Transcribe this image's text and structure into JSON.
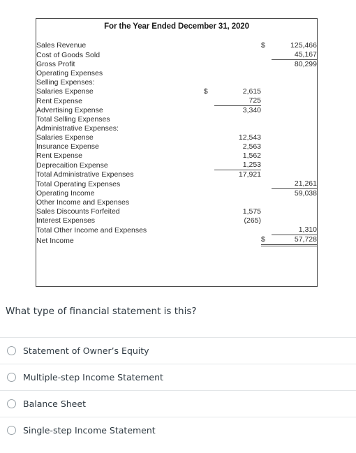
{
  "statement": {
    "title": "For the Year Ended December 31, 2020",
    "rows": [
      {
        "label": "Sales Revenue",
        "indent": 0,
        "cur2": "$",
        "num2": "125,466"
      },
      {
        "label": "Cost of Goods Sold",
        "indent": 0,
        "num2": "45,167",
        "rule2": "under"
      },
      {
        "label": "Gross Profit",
        "indent": 0,
        "num2": "80,299"
      },
      {
        "label": "Operating Expenses",
        "indent": 0
      },
      {
        "label": "Selling Expenses:",
        "indent": 1
      },
      {
        "label": "Salaries Expense",
        "indent": 2,
        "cur1": "$",
        "num1": "2,615"
      },
      {
        "label": "Rent Expense",
        "indent": 2,
        "num1": "725",
        "rule1": "under"
      },
      {
        "label": "Advertising Expense",
        "indent": 2,
        "num1": "3,340"
      },
      {
        "label": "Total Selling Expenses",
        "indent": 2
      },
      {
        "label": "Administrative Expenses:",
        "indent": 1
      },
      {
        "label": "Salaries Expense",
        "indent": 2,
        "num1": "12,543"
      },
      {
        "label": "Insurance Expense",
        "indent": 2,
        "num1": "2,563"
      },
      {
        "label": "Rent Expense",
        "indent": 2,
        "num1": "1,562"
      },
      {
        "label": "Deprecaition Expense",
        "indent": 2,
        "num1": "1,253",
        "rule1": "under"
      },
      {
        "label": "Total Administrative Expenses",
        "indent": 2,
        "num1": "17,921"
      },
      {
        "label": "Total Operating Expenses",
        "indent": 1,
        "num2": "21,261",
        "rule2": "under"
      },
      {
        "label": "Operating Income",
        "indent": 0,
        "num2": "59,038"
      },
      {
        "label": "Other Income and Expenses",
        "indent": 0
      },
      {
        "label": "Sales Discounts Forfeited",
        "indent": 2,
        "num1": "1,575"
      },
      {
        "label": "Interest Expenses",
        "indent": 2,
        "num1": "(265)"
      },
      {
        "label": "Total Other Income and Expenses",
        "indent": 2,
        "num2": "1,310",
        "rule2": "under"
      },
      {
        "label": "Net Income",
        "indent": 0,
        "cur2": "$",
        "num2": "57,728",
        "rule2": "double"
      }
    ]
  },
  "question": {
    "text": "What type of financial statement is this?",
    "options": [
      {
        "label": "Statement of Owner’s Equity"
      },
      {
        "label": "Multiple-step Income Statement"
      },
      {
        "label": "Balance Sheet"
      },
      {
        "label": "Single-step Income Statement"
      }
    ]
  }
}
